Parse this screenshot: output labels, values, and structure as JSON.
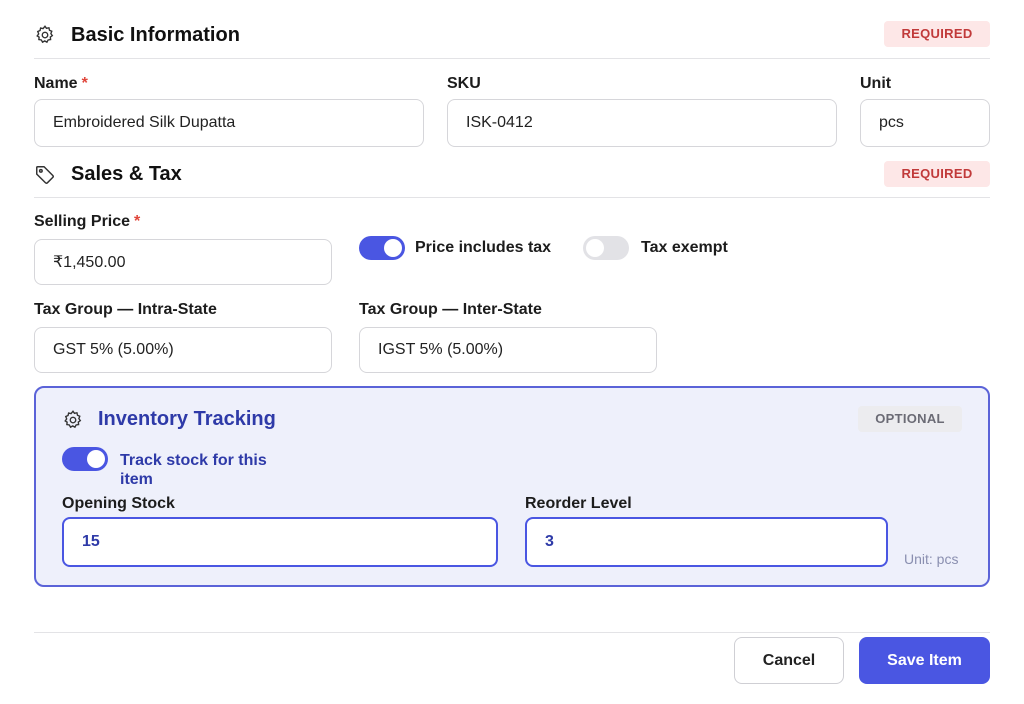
{
  "basic": {
    "title": "Basic Information",
    "badge": "REQUIRED",
    "name_label": "Name",
    "name_required": "*",
    "name_value": "Embroidered Silk Dupatta",
    "sku_label": "SKU",
    "sku_value": "ISK-0412",
    "unit_label": "Unit",
    "unit_value": "pcs",
    "icon": "gear-icon"
  },
  "sales": {
    "title": "Sales & Tax",
    "badge": "REQUIRED",
    "icon": "tag-icon",
    "price_label": "Selling Price",
    "price_required": "*",
    "price_value": "₹1,450.00",
    "price_includes_tax_label": "Price includes tax",
    "price_includes_tax_on": true,
    "tax_exempt_label": "Tax exempt",
    "tax_exempt_on": false,
    "intra_label": "Tax Group — Intra-State",
    "intra_value": "GST 5% (5.00%)",
    "inter_label": "Tax Group — Inter-State",
    "inter_value": "IGST 5% (5.00%)"
  },
  "inventory": {
    "title": "Inventory Tracking",
    "badge": "OPTIONAL",
    "icon": "gear-icon",
    "track_label": "Track stock for this item",
    "track_on": true,
    "opening_label": "Opening Stock",
    "opening_value": "15",
    "reorder_label": "Reorder Level",
    "reorder_value": "3",
    "unit_hint": "Unit: pcs"
  },
  "footer": {
    "cancel_label": "Cancel",
    "save_label": "Save Item"
  },
  "colors": {
    "accent": "#4a56e2",
    "required_badge_bg": "#fde7e7",
    "required_badge_text": "#c13a3a",
    "inventory_bg": "#eef0fb"
  }
}
